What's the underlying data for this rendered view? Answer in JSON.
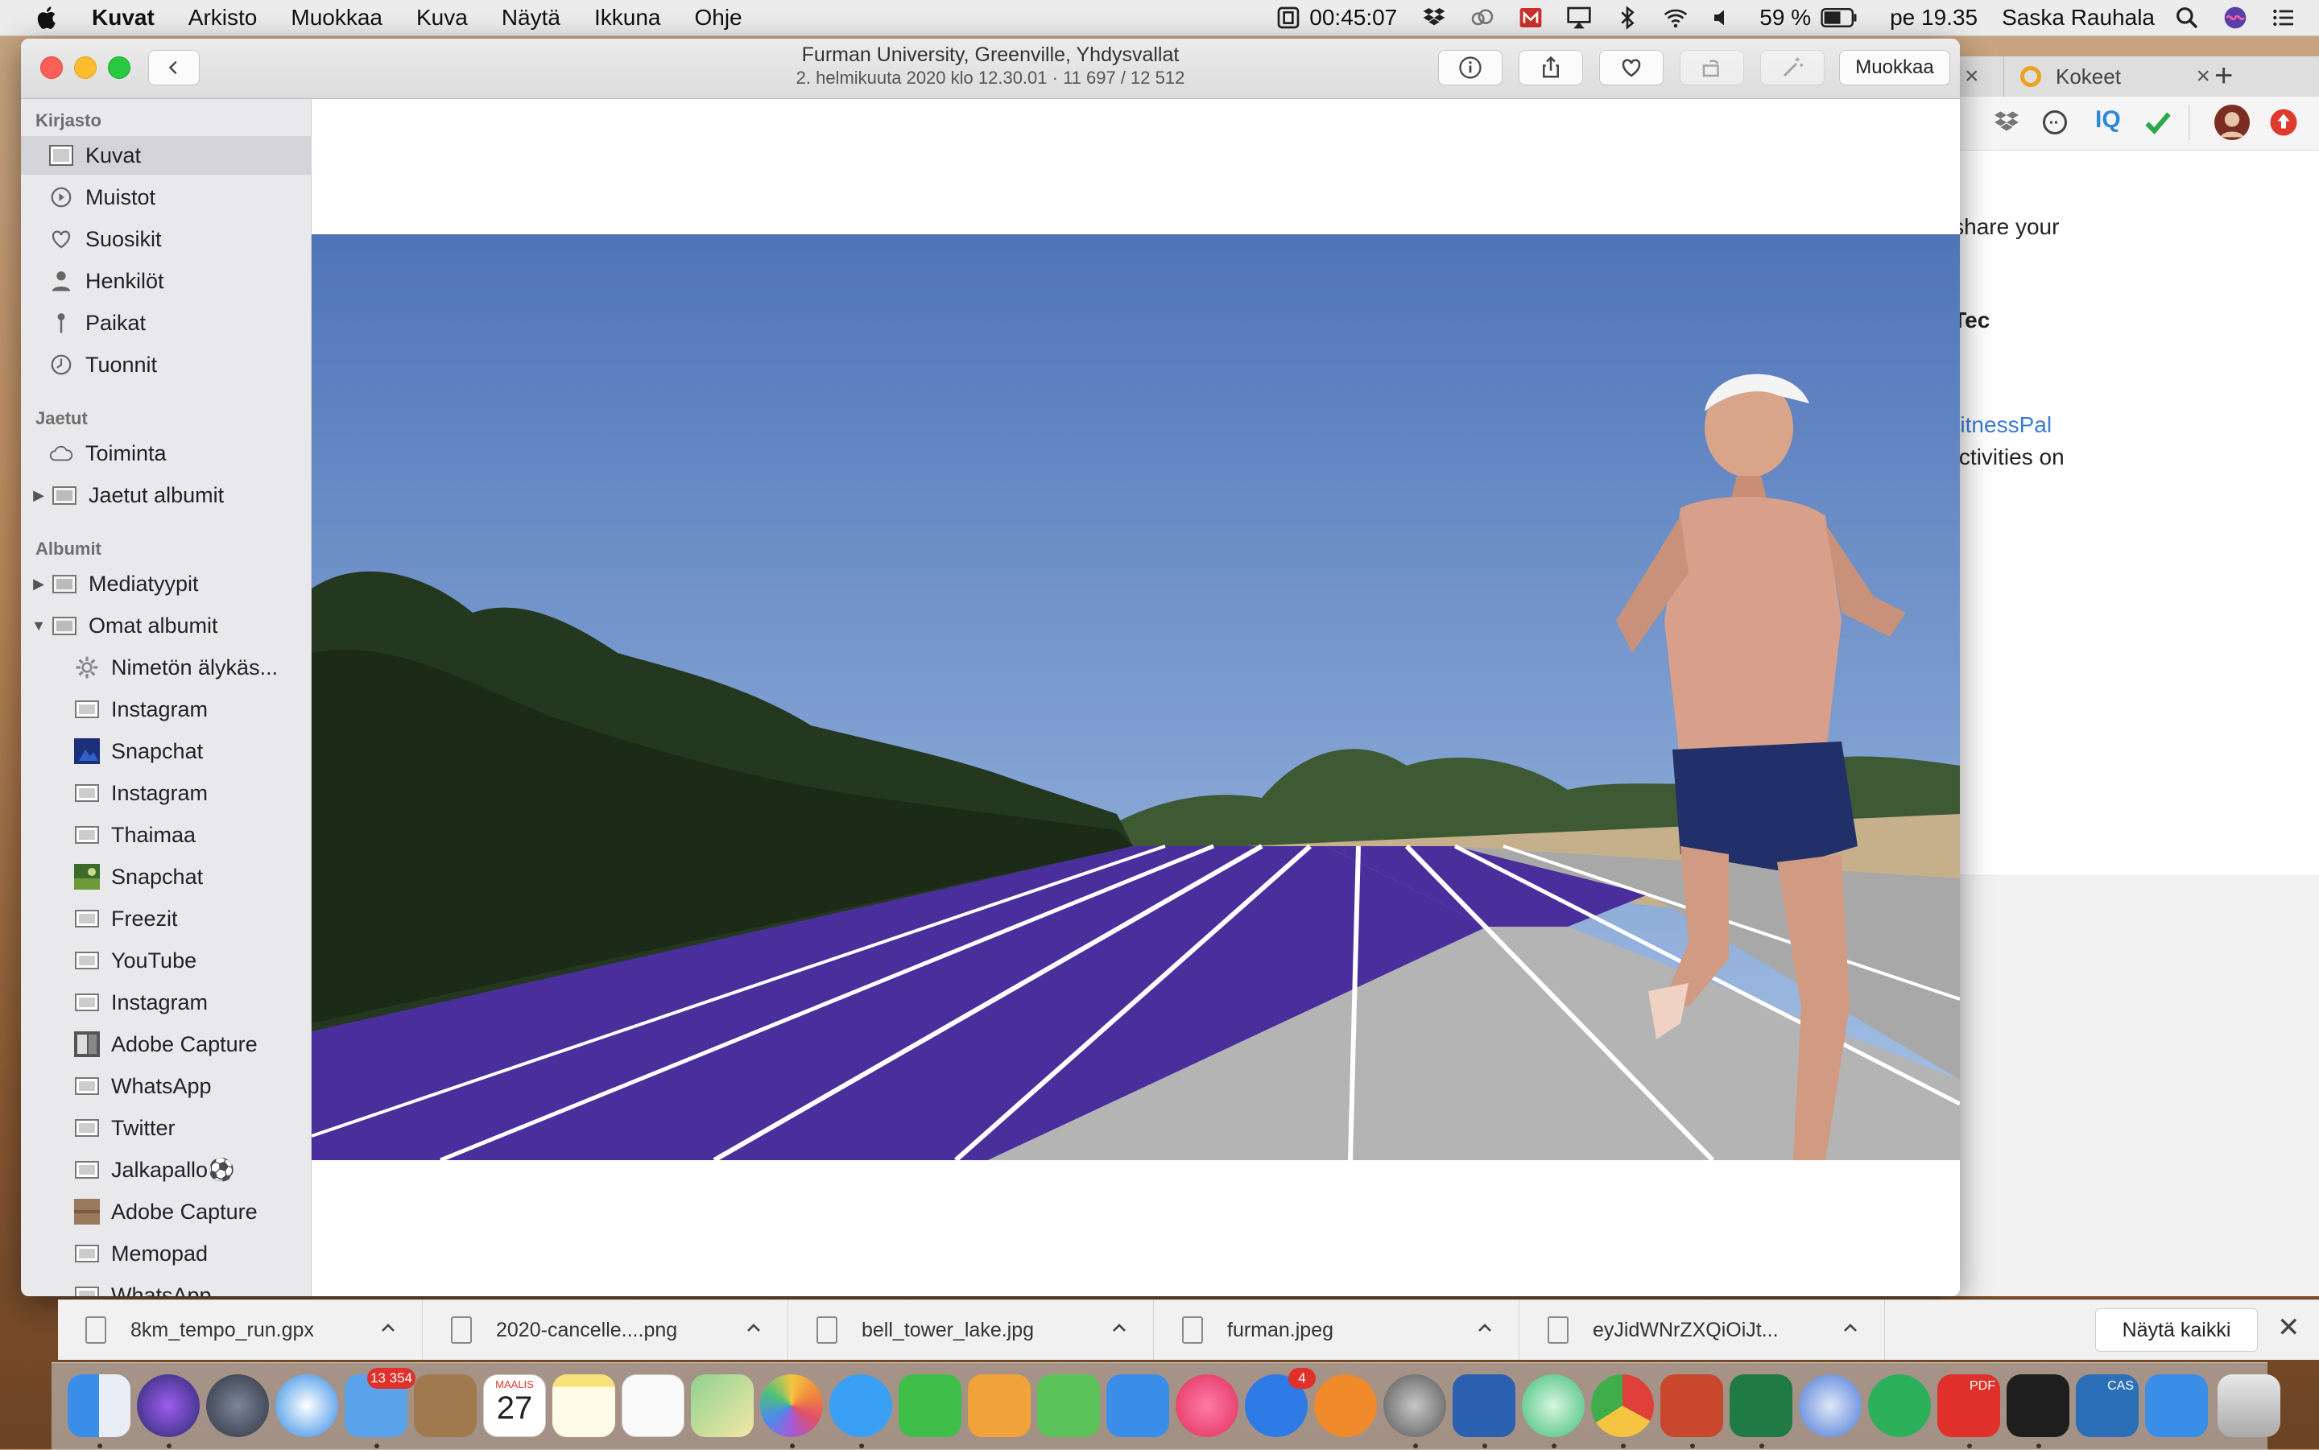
{
  "menubar": {
    "app_name": "Kuvat",
    "menus": [
      "Arkisto",
      "Muokkaa",
      "Kuva",
      "Näytä",
      "Ikkuna",
      "Ohje"
    ],
    "timer": "00:45:07",
    "battery": "59 %",
    "clock": "pe 19.35",
    "user": "Saska Rauhala"
  },
  "browser": {
    "tab_label": "Kokeet",
    "lines": [
      "ds, share your",
      "SarTec",
      "MyFitnessPal",
      "va activities on"
    ]
  },
  "photos_window": {
    "title": "Furman University, Greenville, Yhdysvallat",
    "subtitle": "2. helmikuuta 2020 klo 12.30.01  ·  11 697 / 12 512",
    "edit_label": "Muokkaa"
  },
  "sidebar": {
    "sections": {
      "library": "Kirjasto",
      "shared": "Jaetut",
      "albums": "Albumit"
    },
    "library_items": [
      {
        "label": "Kuvat",
        "icon": "photos-icon"
      },
      {
        "label": "Muistot",
        "icon": "memories-icon"
      },
      {
        "label": "Suosikit",
        "icon": "heart-icon"
      },
      {
        "label": "Henkilöt",
        "icon": "person-icon"
      },
      {
        "label": "Paikat",
        "icon": "pin-icon"
      },
      {
        "label": "Tuonnit",
        "icon": "clock-icon"
      }
    ],
    "shared_items": [
      {
        "label": "Toiminta",
        "icon": "cloud-icon"
      },
      {
        "label": "Jaetut albumit",
        "icon": "folder-icon"
      }
    ],
    "album_groups": [
      {
        "label": "Mediatyypit",
        "icon": "folder-icon"
      },
      {
        "label": "Omat albumit",
        "icon": "folder-icon"
      }
    ],
    "my_albums": [
      {
        "label": "Nimetön älykäs...",
        "icon": "gear-icon"
      },
      {
        "label": "Instagram",
        "icon": "album-icon"
      },
      {
        "label": "Snapchat",
        "icon": "album-thumb-icon"
      },
      {
        "label": "Instagram",
        "icon": "album-icon"
      },
      {
        "label": "Thaimaa",
        "icon": "album-icon"
      },
      {
        "label": "Snapchat",
        "icon": "album-thumb-icon"
      },
      {
        "label": "Freezit",
        "icon": "album-icon"
      },
      {
        "label": "YouTube",
        "icon": "album-icon"
      },
      {
        "label": "Instagram",
        "icon": "album-icon"
      },
      {
        "label": "Adobe Capture",
        "icon": "album-thumb-icon"
      },
      {
        "label": "WhatsApp",
        "icon": "album-icon"
      },
      {
        "label": "Twitter",
        "icon": "album-icon"
      },
      {
        "label": "Jalkapallo⚽",
        "icon": "album-icon"
      },
      {
        "label": "Adobe Capture",
        "icon": "album-thumb-icon"
      },
      {
        "label": "Memopad",
        "icon": "album-icon"
      },
      {
        "label": "WhatsApp",
        "icon": "album-icon"
      }
    ]
  },
  "downloads": {
    "files": [
      "8km_tempo_run.gpx",
      "2020-cancelle....png",
      "bell_tower_lake.jpg",
      "furman.jpeg",
      "eyJidWNrZXQiOiJt..."
    ],
    "show_all_label": "Näytä kaikki"
  },
  "dock": {
    "mail_badge": "13 354",
    "calendar_month": "MAALIS",
    "calendar_day": "27",
    "appstore_badge": "4",
    "pdf_label": "PDF",
    "cas_label": "CAS"
  }
}
